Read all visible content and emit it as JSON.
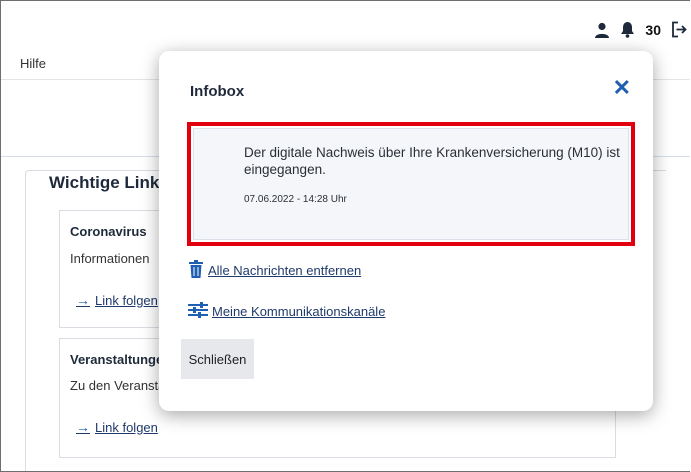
{
  "header": {
    "notification_count": "30",
    "help_label": "Hilfe"
  },
  "section": {
    "title": "Wichtige Links",
    "cards": [
      {
        "title": "Coronavirus",
        "text": "Informationen",
        "link": "Link folgen"
      },
      {
        "title": "Veranstaltungen",
        "text": "Zu den Veranstaltungen",
        "link": "Link folgen"
      }
    ]
  },
  "infobox": {
    "title": "Infobox",
    "message": {
      "text": "Der digitale Nachweis über Ihre Krankenversicherung (M10) ist eingegangen.",
      "date": "07.06.2022 - 14:28 Uhr"
    },
    "remove_all_label": "Alle Nachrichten entfernen",
    "channels_label": "Meine Kommunikationskanäle",
    "close_label": "Schließen"
  },
  "colors": {
    "accent": "#1f5fb1",
    "highlight_border": "#e2000f"
  }
}
